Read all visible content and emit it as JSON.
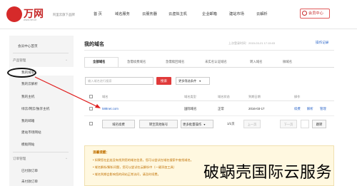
{
  "header": {
    "logo_text": "万网",
    "logo_sub": "www.net.cn",
    "slogan": "阿里云旗下品牌",
    "nav": [
      "首 页",
      "域名服务",
      "云服务器",
      "云虚拟主机",
      "企业邮箱",
      "建站市场",
      "云解析"
    ],
    "member_center": "会员中心"
  },
  "sidebar": {
    "home": "会员中心首页",
    "section_products": "产品管理",
    "items": [
      "我的域名",
      "我的云解析",
      "我的主机",
      "绿云/网云/独享主机",
      "我的邮箱",
      "建站市场网站",
      "模板网站"
    ],
    "section_orders": "订单管理",
    "order_items": [
      "已付款订单",
      "未付款订单"
    ]
  },
  "main": {
    "title": "我的域名",
    "login_info": "上次登录时间：2015-03-21 17:15:03",
    "op_log": "操作记录",
    "tabs": [
      "全部域名",
      "急需续费域名",
      "急需赎回域名",
      "未实名认证域名",
      "转入域名",
      "微域名"
    ],
    "search_placeholder": "输入域名进行搜索",
    "search_button": "搜索",
    "filter_select": "更多筛选条件",
    "columns": [
      "域名",
      "域名类型",
      "域名状态",
      "到期日期",
      "操作"
    ],
    "rows": [
      {
        "domain": "588net.com",
        "type": "国际域名",
        "status": "正常",
        "expiry": "2016-03-17",
        "actions": [
          "续费",
          "解析",
          "管理"
        ]
      }
    ],
    "batch_renew": "域名续费",
    "transfer_button": "转至其他账号",
    "more_ops": "更多批量操作",
    "pager_text": "1/1页",
    "prev_page": "上一页",
    "next_page": "下一页",
    "jump_button": "跳转"
  },
  "tips": {
    "title": "温馨提醒：",
    "lines": [
      "• 如果您在此处没有找到您的域名信息，您可以尝试在域名搜索中查找域名。",
      "• 域名解析/解析问题，您可以尝试在云解析中（一键添加工具）",
      "• 域名到期会影响您的网站正常访问，请及时续费。"
    ]
  },
  "watermark": "破蜗壳国际云服务"
}
